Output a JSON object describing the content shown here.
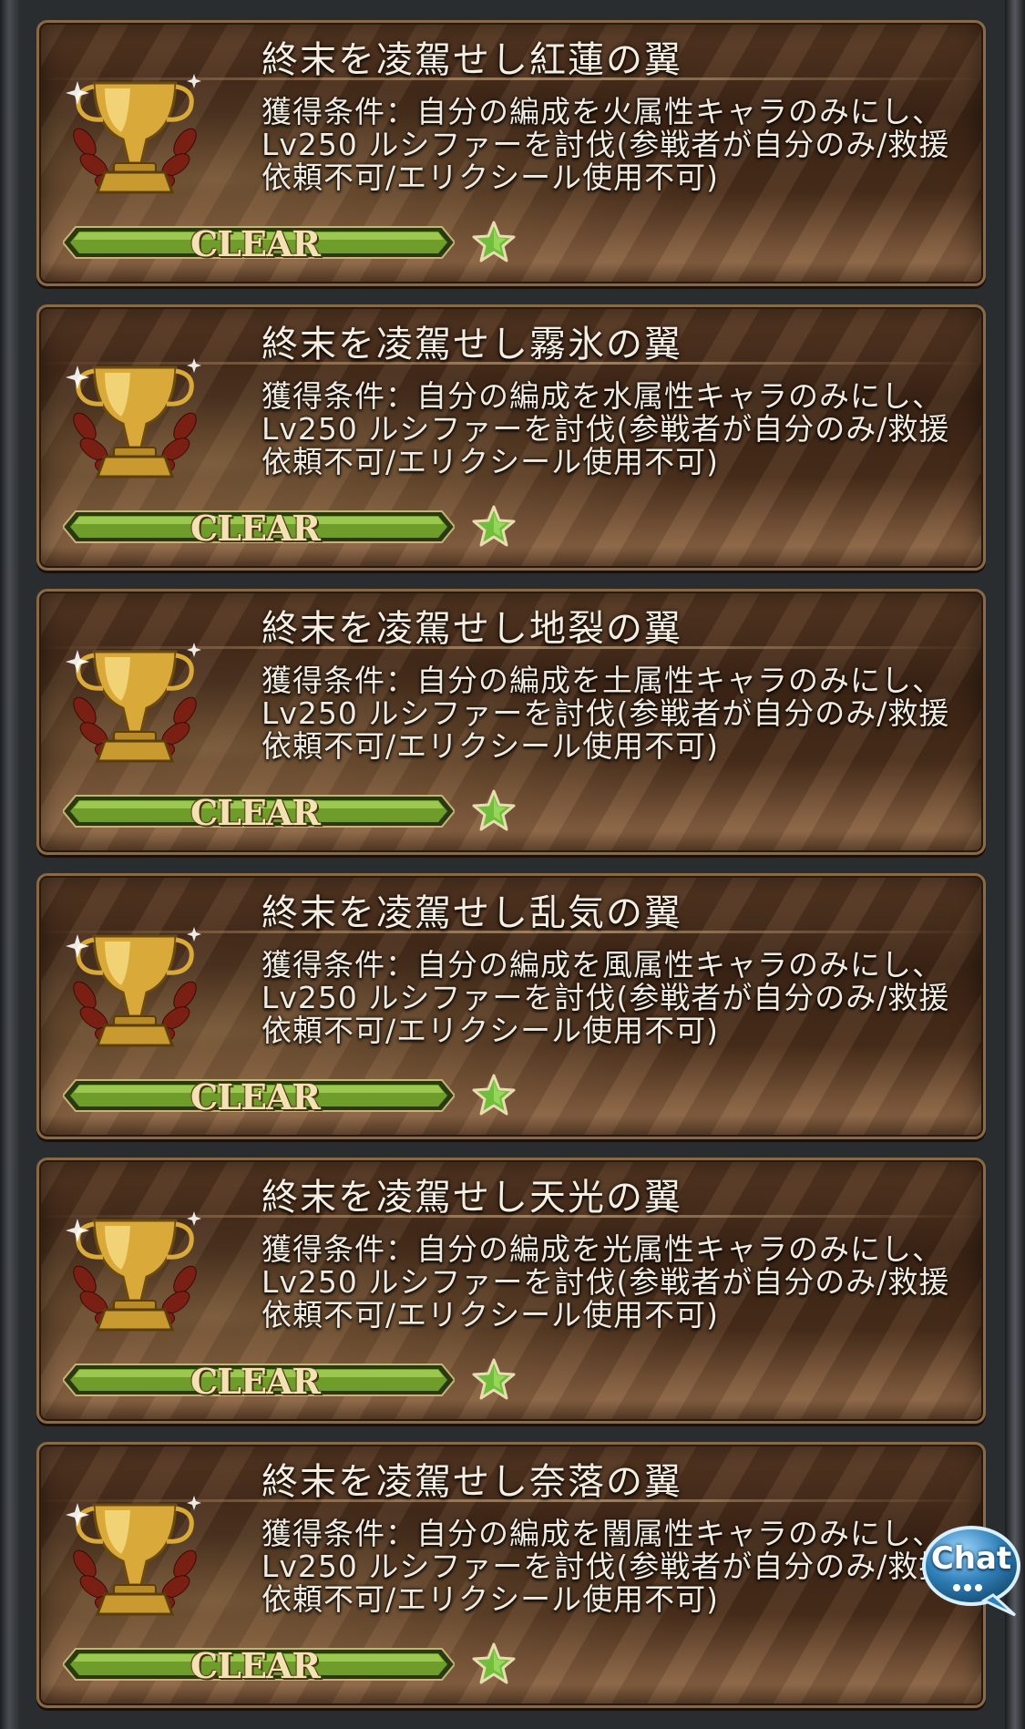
{
  "achievements": [
    {
      "title": "終末を凌駕せし紅蓮の翼",
      "desc_line1": "獲得条件：自分の編成を火属性キャラのみにし、",
      "desc_line2": "Lv250 ルシファーを討伐(参戦者が自分のみ/救援",
      "desc_line3": "依頼不可/エリクシール使用不可)",
      "progress": 1.0,
      "status": "CLEAR",
      "icons": [
        "trophy-icon",
        "star-icon"
      ]
    },
    {
      "title": "終末を凌駕せし霧氷の翼",
      "desc_line1": "獲得条件：自分の編成を水属性キャラのみにし、",
      "desc_line2": "Lv250 ルシファーを討伐(参戦者が自分のみ/救援",
      "desc_line3": "依頼不可/エリクシール使用不可)",
      "progress": 1.0,
      "status": "CLEAR",
      "icons": [
        "trophy-icon",
        "star-icon"
      ]
    },
    {
      "title": "終末を凌駕せし地裂の翼",
      "desc_line1": "獲得条件：自分の編成を土属性キャラのみにし、",
      "desc_line2": "Lv250 ルシファーを討伐(参戦者が自分のみ/救援",
      "desc_line3": "依頼不可/エリクシール使用不可)",
      "progress": 1.0,
      "status": "CLEAR",
      "icons": [
        "trophy-icon",
        "star-icon"
      ]
    },
    {
      "title": "終末を凌駕せし乱気の翼",
      "desc_line1": "獲得条件：自分の編成を風属性キャラのみにし、",
      "desc_line2": "Lv250 ルシファーを討伐(参戦者が自分のみ/救援",
      "desc_line3": "依頼不可/エリクシール使用不可)",
      "progress": 1.0,
      "status": "CLEAR",
      "icons": [
        "trophy-icon",
        "star-icon"
      ]
    },
    {
      "title": "終末を凌駕せし天光の翼",
      "desc_line1": "獲得条件：自分の編成を光属性キャラのみにし、",
      "desc_line2": "Lv250 ルシファーを討伐(参戦者が自分のみ/救援",
      "desc_line3": "依頼不可/エリクシール使用不可)",
      "progress": 1.0,
      "status": "CLEAR",
      "icons": [
        "trophy-icon",
        "star-icon"
      ]
    },
    {
      "title": "終末を凌駕せし奈落の翼",
      "desc_line1": "獲得条件：自分の編成を闇属性キャラのみにし、",
      "desc_line2": "Lv250 ルシファーを討伐(参戦者が自分のみ/救援",
      "desc_line3": "依頼不可/エリクシール使用不可)",
      "progress": 1.0,
      "status": "CLEAR",
      "icons": [
        "trophy-icon",
        "star-icon"
      ]
    }
  ],
  "chat_button": {
    "label": "Chat",
    "icon": "chat-bubble-icon"
  },
  "colors": {
    "card_bg": "#3d2516",
    "card_border": "#8a6a44",
    "bar_fill": "#7fb23a",
    "bar_frame": "#2a3a10",
    "clear_text": "#f3e2b4",
    "star": "#6fbf3a",
    "chat_bubble": "#2f7fb8"
  }
}
